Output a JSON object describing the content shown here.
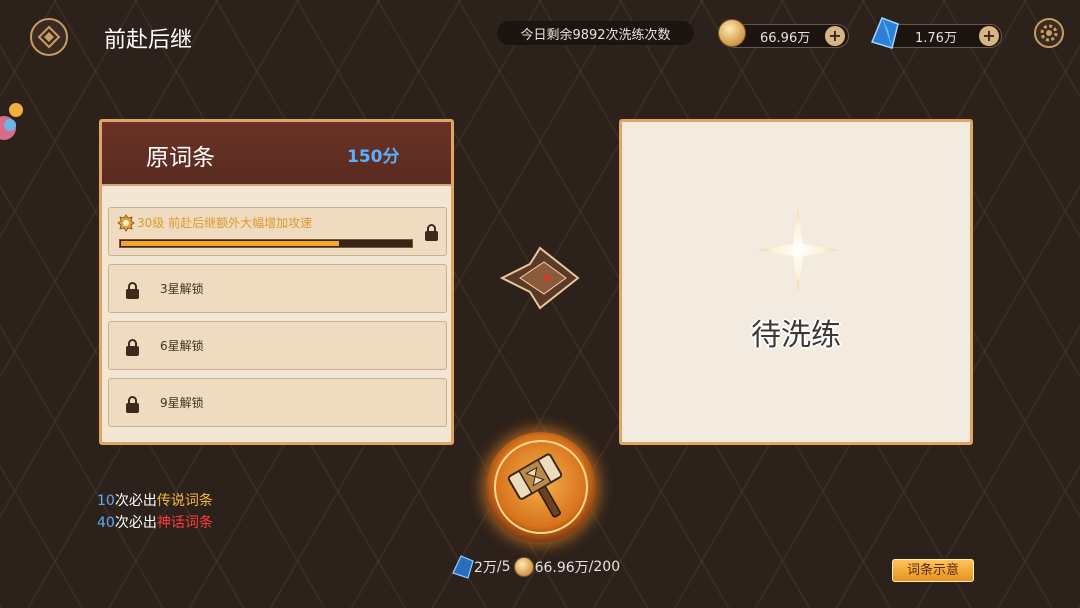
{
  "header": {
    "title": "前赴后继",
    "daily_remaining": "今日剩余9892次洗练次数",
    "coins": "66.96万",
    "gems": "1.76万"
  },
  "original_affixes": {
    "title": "原词条",
    "score": "150分",
    "rows": [
      {
        "text": "30级 前赴后继额外大幅增加攻速",
        "progress": 0.75,
        "locked": true
      },
      {
        "text": "3星解锁",
        "locked": true
      },
      {
        "text": "6星解锁",
        "locked": true
      },
      {
        "text": "9星解锁",
        "locked": true
      }
    ]
  },
  "result_panel": {
    "status": "待洗练"
  },
  "guarantees": [
    {
      "count": "10",
      "mid": "次必出",
      "tier": "传说词条"
    },
    {
      "count": "40",
      "mid": "次必出",
      "tier": "神话词条"
    }
  ],
  "cost": {
    "gem_cost": "2万",
    "gem_sep": "/",
    "gem_count": "5",
    "coin_value": "66.96万",
    "coin_sep": "/",
    "coin_cost": "200"
  },
  "buttons": {
    "affix_preview": "词条示意"
  },
  "icons": {
    "back": "back-icon",
    "settings": "gear-icon",
    "coin": "coin-icon",
    "gem": "gem-icon",
    "lock": "lock-icon",
    "arrow": "arrow-right-icon",
    "sparkle": "sparkle-icon",
    "hammer": "hammer-icon"
  },
  "colors": {
    "panel_border": "#e0a560",
    "header_bg": "#5a2a20",
    "score": "#5ab0ff",
    "legendary": "#f6b73c",
    "mythic": "#ff3b3b",
    "progress_fill": "#f3a82a"
  }
}
